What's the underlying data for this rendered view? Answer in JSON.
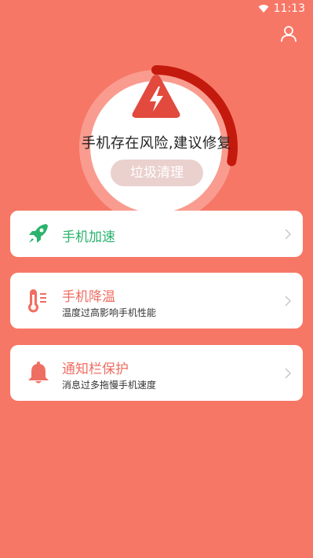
{
  "status_bar": {
    "time": "11:13"
  },
  "header": {
    "user_icon": "user-icon"
  },
  "hero": {
    "warning_icon": "warning-bolt-icon",
    "headline": "手机存在风险,建议修复",
    "button_label": "垃圾清理",
    "gauge_fill_fraction": 0.28
  },
  "cards": [
    {
      "title": "手机加速",
      "subtitle": "",
      "icon": "rocket-icon",
      "title_color": "#2ab36c"
    },
    {
      "title": "手机降温",
      "subtitle": "温度过高影响手机性能",
      "icon": "thermometer-icon",
      "title_color": "#ef6e63"
    },
    {
      "title": "通知栏保护",
      "subtitle": "消息过多拖慢手机速度",
      "icon": "bell-icon",
      "title_color": "#ef6e63"
    }
  ],
  "colors": {
    "background": "#f77766",
    "gauge_active": "#c41a0e",
    "gauge_track": "#f9a89e",
    "accent_red": "#e14a3d",
    "accent_green": "#2ab36c"
  }
}
